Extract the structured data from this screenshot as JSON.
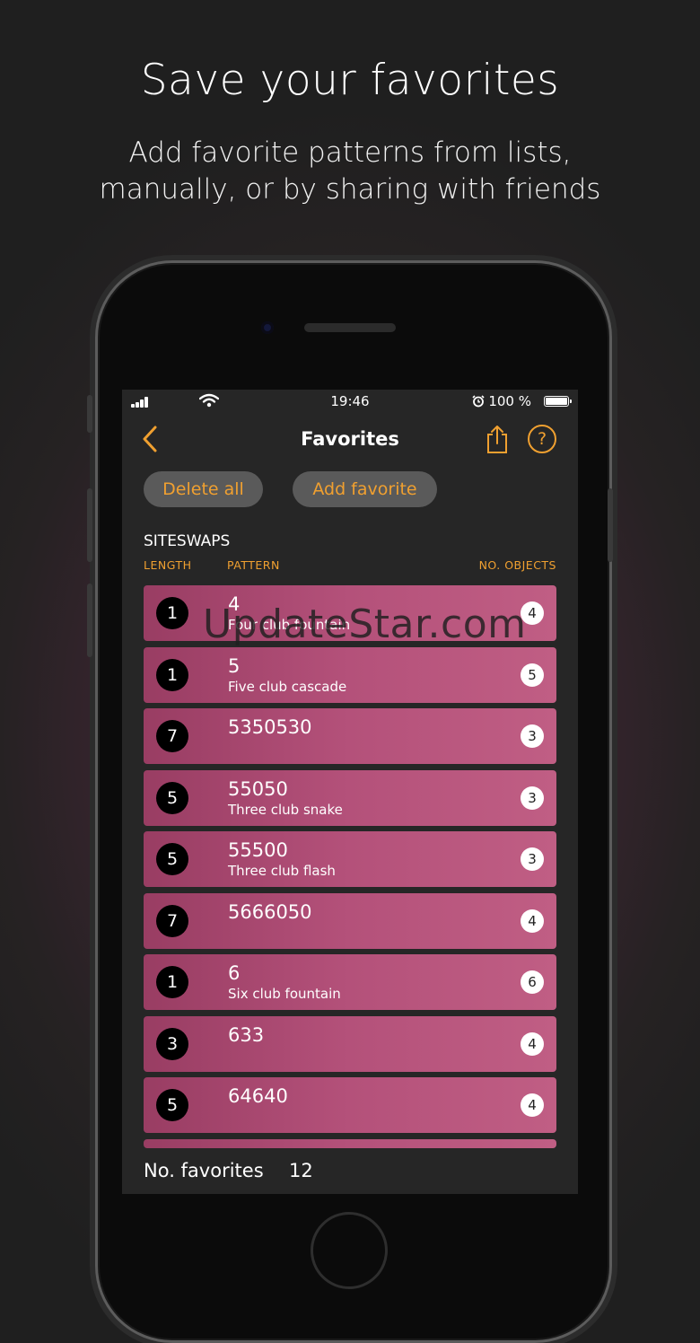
{
  "promo": {
    "headline": "Save your favorites",
    "subline_1": "Add favorite patterns from lists,",
    "subline_2": "manually, or by sharing with friends"
  },
  "status_bar": {
    "time": "19:46",
    "battery_text": "100 %"
  },
  "nav": {
    "title": "Favorites",
    "help_label": "?"
  },
  "actions": {
    "delete_all": "Delete all",
    "add_favorite": "Add favorite"
  },
  "list": {
    "section_title": "SITESWAPS",
    "col_length": "LENGTH",
    "col_pattern": "PATTERN",
    "col_objects": "NO. OBJECTS",
    "rows": [
      {
        "length": "1",
        "pattern": "4",
        "name": "Four club fountain",
        "objects": "4"
      },
      {
        "length": "1",
        "pattern": "5",
        "name": "Five club cascade",
        "objects": "5"
      },
      {
        "length": "7",
        "pattern": "5350530",
        "name": "",
        "objects": "3"
      },
      {
        "length": "5",
        "pattern": "55050",
        "name": "Three club snake",
        "objects": "3"
      },
      {
        "length": "5",
        "pattern": "55500",
        "name": "Three club flash",
        "objects": "3"
      },
      {
        "length": "7",
        "pattern": "5666050",
        "name": "",
        "objects": "4"
      },
      {
        "length": "1",
        "pattern": "6",
        "name": "Six club fountain",
        "objects": "6"
      },
      {
        "length": "3",
        "pattern": "633",
        "name": "",
        "objects": "4"
      },
      {
        "length": "5",
        "pattern": "64640",
        "name": "",
        "objects": "4"
      }
    ]
  },
  "footer": {
    "label": "No. favorites",
    "count": "12"
  },
  "watermark": "UpdateStar.com",
  "colors": {
    "accent": "#f0a030",
    "row_pink": "#b4517a",
    "screen_bg": "#262626"
  }
}
